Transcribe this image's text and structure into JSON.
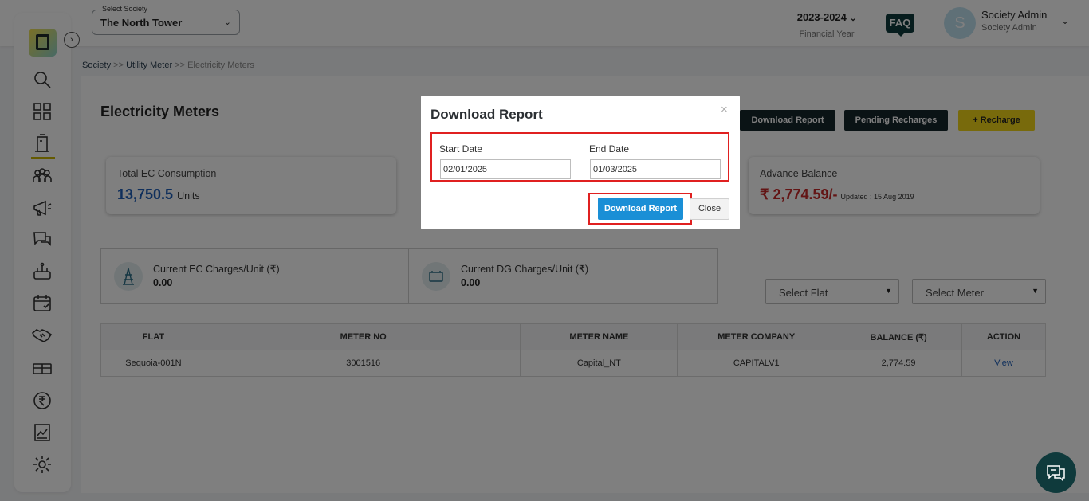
{
  "header": {
    "society_label": "Select Society",
    "society_value": "The North Tower",
    "financial_year": "2023-2024",
    "financial_year_label": "Financial Year",
    "faq": "FAQ",
    "avatar_letter": "S",
    "user_name": "Society Admin",
    "user_role": "Society Admin"
  },
  "breadcrumb": {
    "society": "Society",
    "utility_meter": "Utility Meter",
    "current": "Electricity Meters",
    "sep": ">>"
  },
  "page": {
    "title": "Electricity Meters",
    "buttons": {
      "download_report": "Download Report",
      "pending_recharges": "Pending Recharges",
      "recharge": "+ Recharge"
    },
    "cards": {
      "total_ec_label": "Total EC Consumption",
      "total_ec_value": "13,750.5",
      "total_ec_unit": "Units",
      "advance_label": "Advance Balance",
      "advance_value": "₹ 2,774.59/-",
      "advance_updated": "Updated : 15 Aug 2019"
    },
    "charges": {
      "ec_label": "Current EC Charges/Unit (₹)",
      "ec_value": "0.00",
      "dg_label": "Current DG Charges/Unit (₹)",
      "dg_value": "0.00"
    },
    "filters": {
      "flat": "Select Flat",
      "meter": "Select Meter"
    },
    "table": {
      "headers": [
        "FLAT",
        "METER NO",
        "METER NAME",
        "METER COMPANY",
        "BALANCE (₹)",
        "ACTION"
      ],
      "rows": [
        [
          "Sequoia-001N",
          "3001516",
          "Capital_NT",
          "CAPITALV1",
          "2,774.59",
          "View"
        ]
      ]
    }
  },
  "modal": {
    "title": "Download Report",
    "close_x": "×",
    "start_label": "Start Date",
    "start_value": "02/01/2025",
    "end_label": "End Date",
    "end_value": "01/03/2025",
    "download_button": "Download Report",
    "close_button": "Close"
  },
  "colors": {
    "brand_dark": "#0f3a3c",
    "accent_yellow": "#f0d418",
    "primary_blue": "#1a8fd6",
    "highlight_red": "#e02020"
  },
  "sidebar": {
    "icons": [
      "search-icon",
      "dashboard-icon",
      "building-icon",
      "people-icon",
      "megaphone-icon",
      "chat-icon",
      "amenity-icon",
      "calendar-icon",
      "handshake-icon",
      "gift-icon",
      "rupee-icon",
      "report-icon",
      "gear-icon"
    ]
  }
}
